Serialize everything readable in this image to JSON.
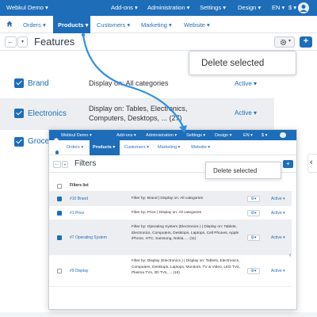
{
  "topbar": {
    "store": "Webkul Demo",
    "menu": [
      "Add-ons",
      "Administration",
      "Settings",
      "Design"
    ],
    "language": "EN",
    "currency": "$"
  },
  "nav": {
    "items": [
      "Orders",
      "Products",
      "Customers",
      "Marketing",
      "Website"
    ]
  },
  "page": {
    "title": "Features"
  },
  "dropdown": {
    "delete_label": "Delete selected"
  },
  "features": [
    {
      "name": "Brand",
      "display": "Display on: All categories",
      "status": "Active"
    },
    {
      "name": "Electronics",
      "display": "Display on: Tables, Electronics, Computers, Desktops, ... (27)",
      "status": "Active"
    },
    {
      "name": "Groce",
      "display": "",
      "status": ""
    }
  ],
  "inset": {
    "topbar": {
      "store": "Webkul Demo",
      "menu": [
        "Add-ons",
        "Administration",
        "Settings",
        "Design"
      ],
      "language": "EN",
      "currency": "$"
    },
    "nav": {
      "items": [
        "Orders",
        "Products",
        "Customers",
        "Marketing",
        "Website"
      ]
    },
    "page": {
      "title": "Filters"
    },
    "dropdown": {
      "delete_label": "Delete selected"
    },
    "list_header": "Filters list",
    "filters": [
      {
        "name": "#10 Brand",
        "display": "Filter by: Brand | Display on: All categories",
        "status": "Active",
        "checked": true
      },
      {
        "name": "#1 Price",
        "display": "Filter by: Price | Display on: All categories",
        "status": "Active",
        "checked": true
      },
      {
        "name": "#7 Operating System",
        "display": "Filter by: Operating System (Electronics ) | Display on: Tablets, Electronics, Computers, Desktops, Laptops, Cell Phones, Apple iPhone, HTC, Samsung, Nokia, ... (11)",
        "status": "Active",
        "checked": true
      },
      {
        "name": "#9 Display",
        "display": "Filter by: Display (Electronics ) | Display on: Tablets, Electronics, Computers, Desktops, Laptops, Monitors, TV & Video, LED TVs, Plasma TVs, 3D TVs, ... (16)",
        "status": "Active",
        "checked": false
      }
    ]
  },
  "colors": {
    "brand": "#1d6db8",
    "arrow": "#2f8fe3"
  }
}
